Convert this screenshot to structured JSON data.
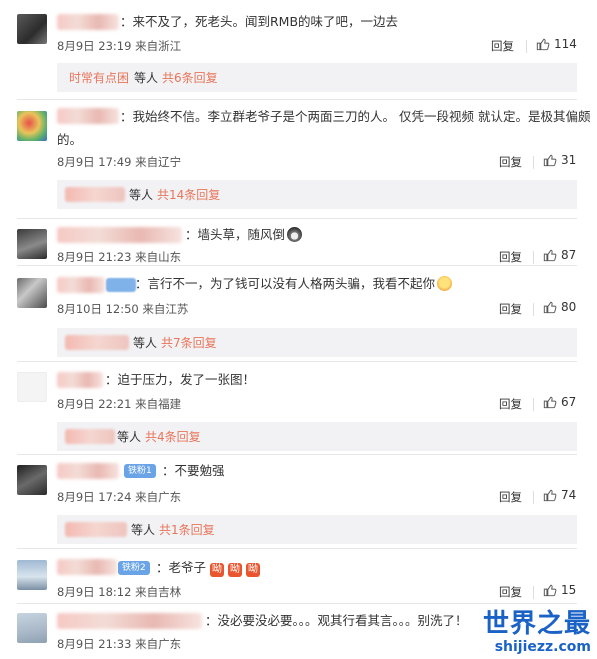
{
  "labels": {
    "reply": "回复"
  },
  "comments": [
    {
      "text": "：来不及了，死老头。闻到RMB的味了吧，一边去",
      "date": "8月9日 23:19",
      "location": "来自浙江",
      "likes": "114",
      "sub": {
        "lead": "时常有点困",
        "etc": "等人",
        "count": "共6条回复"
      }
    },
    {
      "text_line1": "：我始终不信。李立群老爷子是个两面三刀的人。 仅凭一段视频 就认定。是极其偏颇",
      "text_line2": "的。",
      "date": "8月9日 17:49",
      "location": "来自辽宁",
      "likes": "31",
      "sub": {
        "etc": "等人",
        "count": "共14条回复"
      }
    },
    {
      "text": "：墙头草，随风倒",
      "date": "8月9日 21:23",
      "location": "来自山东",
      "likes": "87"
    },
    {
      "text": "：言行不一，为了钱可以没有人格两头骗，我看不起你",
      "date": "8月10日 12:50",
      "location": "来自江苏",
      "likes": "80",
      "sub": {
        "etc": "等人",
        "count": "共7条回复"
      }
    },
    {
      "text": "：迫于压力，发了一张图！",
      "date": "8月9日 22:21",
      "location": "来自福建",
      "likes": "67",
      "sub": {
        "etc": "等人",
        "count": "共4条回复"
      }
    },
    {
      "badge": "铁粉1",
      "text": "：不要勉强",
      "date": "8月9日 17:24",
      "location": "来自广东",
      "likes": "74",
      "sub": {
        "etc": "等人",
        "count": "共1条回复"
      }
    },
    {
      "badge": "铁粉2",
      "text": "：老爷子",
      "emoji_text": "呦",
      "date": "8月9日 18:12",
      "location": "来自吉林",
      "likes": "15"
    },
    {
      "text": "：没必要没必要。。。观其行看其言。。。别洗了！",
      "date": "8月9日 21:33",
      "location": "来自广东"
    }
  ],
  "watermark": {
    "title": "世界之最",
    "url": "shijiezz.com"
  },
  "colors": {
    "accent": "#e8755a",
    "sub_bg": "#f2f2f5",
    "badge": "#6aa4e6",
    "watermark": "#1b62c6"
  },
  "icons": {
    "like": "thumbs-up-icon"
  }
}
